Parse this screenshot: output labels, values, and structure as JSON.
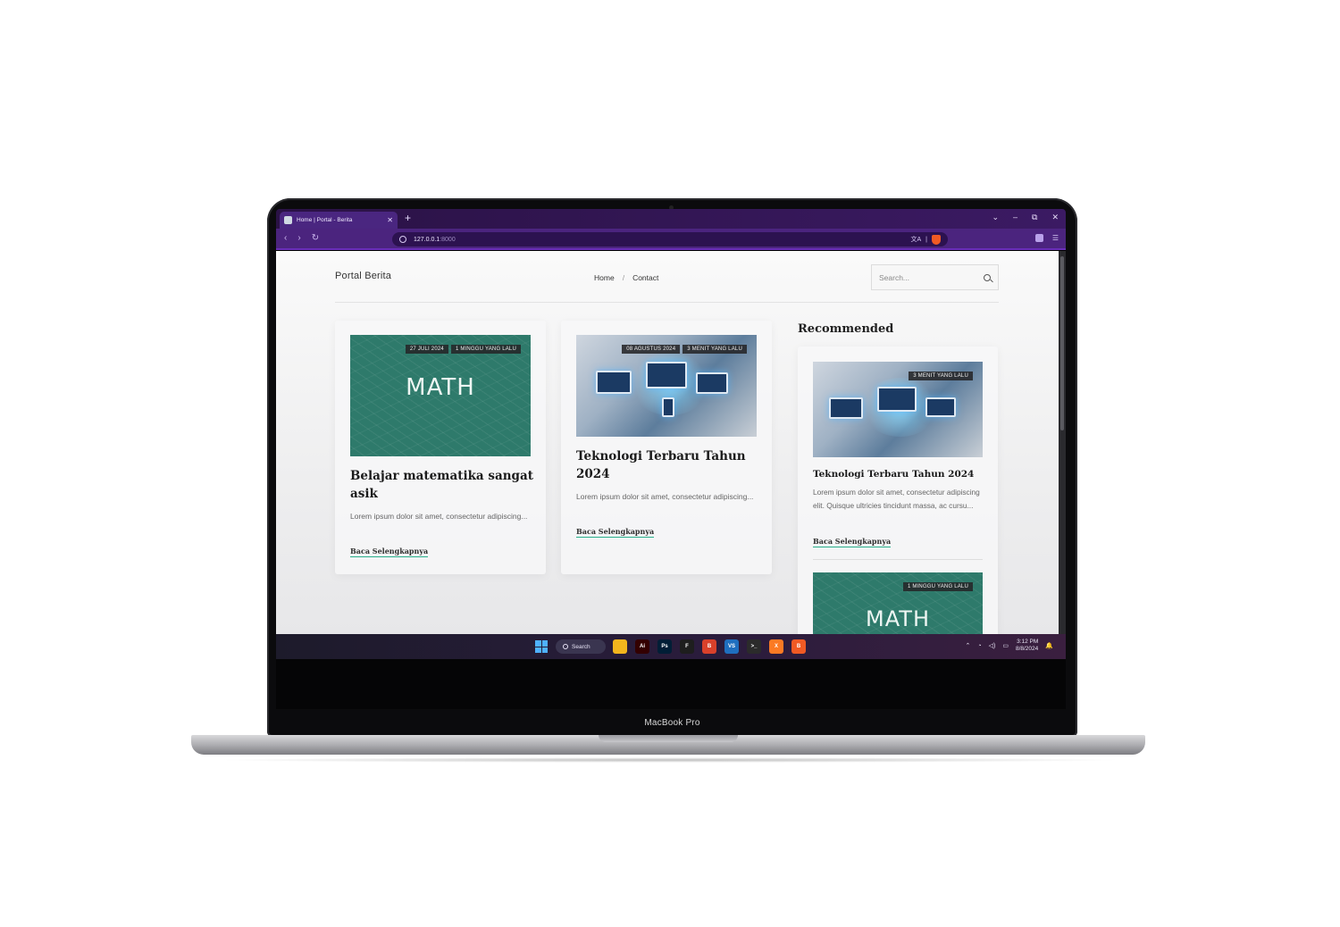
{
  "device": {
    "bezel_label": "MacBook Pro"
  },
  "browser": {
    "tab_title": "Home | Portal - Berita",
    "new_tab": "+",
    "url_host": "127.0.0.1",
    "url_port": ":8000",
    "translate_glyph": "文A",
    "window_controls": [
      "⌄",
      "–",
      "⧉",
      "✕"
    ]
  },
  "site": {
    "brand": "Portal Berita",
    "nav": {
      "home": "Home",
      "separator": "/",
      "contact": "Contact"
    },
    "search_placeholder": "Search..."
  },
  "articles": [
    {
      "image": "math",
      "image_word": "MATH",
      "date": "27 JULI 2024",
      "ago": "1 MINGGU YANG LALU",
      "title": "Belajar matematika sangat asik",
      "excerpt": "Lorem ipsum dolor sit amet, consectetur adipiscing...",
      "read_more": "Baca Selengkapnya"
    },
    {
      "image": "technology",
      "date": "08 AGUSTUS 2024",
      "ago": "3 MENIT YANG LALU",
      "title": "Teknologi Terbaru Tahun 2024",
      "excerpt": "Lorem ipsum dolor sit amet, consectetur adipiscing...",
      "read_more": "Baca Selengkapnya"
    }
  ],
  "recommended": {
    "heading": "Recommended",
    "items": [
      {
        "image": "technology",
        "ago": "3 MENIT YANG LALU",
        "title": "Teknologi Terbaru Tahun 2024",
        "excerpt": "Lorem ipsum dolor sit amet, consectetur adipiscing elit. Quisque ultricies tincidunt massa, ac cursu...",
        "read_more": "Baca Selengkapnya"
      },
      {
        "image": "math",
        "image_word": "MATH",
        "ago": "1 MINGGU YANG LALU"
      }
    ]
  },
  "taskbar": {
    "search_label": "Search",
    "apps": [
      {
        "name": "file-explorer",
        "glyph": "",
        "color": "#f2b51d"
      },
      {
        "name": "illustrator",
        "glyph": "Ai",
        "color": "#330000"
      },
      {
        "name": "photoshop",
        "glyph": "Ps",
        "color": "#001e36"
      },
      {
        "name": "figma",
        "glyph": "F",
        "color": "#1e1e1e"
      },
      {
        "name": "brave-nightly",
        "glyph": "B",
        "color": "#d9412b"
      },
      {
        "name": "vscode",
        "glyph": "VS",
        "color": "#1f6fbf"
      },
      {
        "name": "terminal",
        "glyph": ">_",
        "color": "#2b2b2b"
      },
      {
        "name": "xampp",
        "glyph": "X",
        "color": "#fb7a24"
      },
      {
        "name": "brave",
        "glyph": "B",
        "color": "#f05a24"
      }
    ],
    "time": "3:12 PM",
    "date": "8/8/2024"
  },
  "colors": {
    "accent": "#4b247e",
    "link_underline": "#27ae8a"
  }
}
